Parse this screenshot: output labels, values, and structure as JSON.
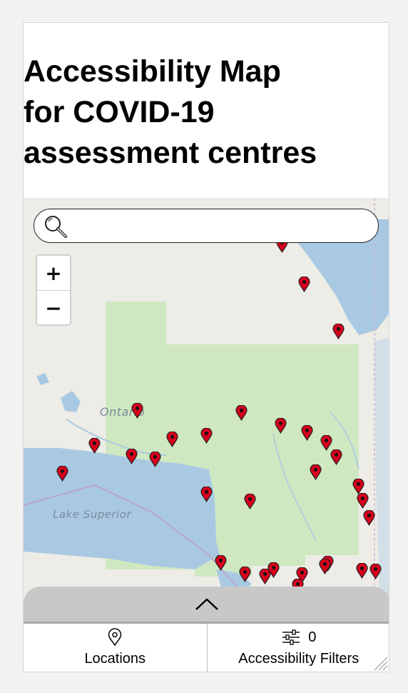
{
  "page": {
    "title": "Accessibility Map\nfor COVID-19\nassessment centres"
  },
  "search": {
    "value": "",
    "placeholder": "",
    "icon": "search-icon"
  },
  "zoom": {
    "in_label": "+",
    "out_label": "−"
  },
  "map": {
    "labels": {
      "province": "Ontario",
      "lake": "Lake Superior"
    },
    "colors": {
      "land": "#eeece6",
      "park": "#cfe8c2",
      "water": "#a9c9e3",
      "marker": "#d6001c"
    },
    "marker_icon": "map-pin-icon"
  },
  "drawer": {
    "icon": "chevron-up-icon"
  },
  "tabs": {
    "locations": {
      "label": "Locations",
      "icon": "location-pin-icon"
    },
    "filters": {
      "label": "Accessibility Filters",
      "count": "0",
      "icon": "sliders-icon"
    }
  }
}
